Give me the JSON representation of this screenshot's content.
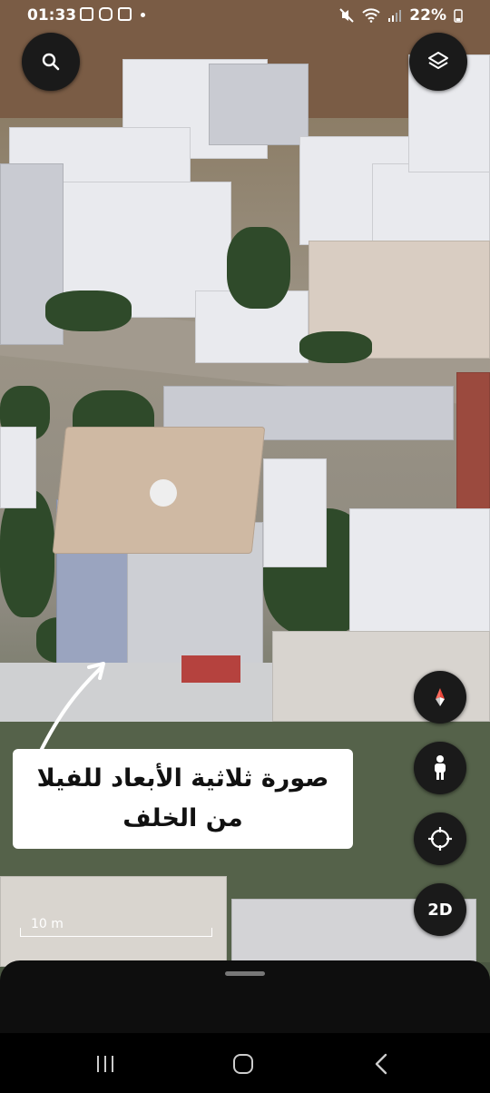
{
  "status_bar": {
    "time": "01:33",
    "battery": "22%"
  },
  "map": {
    "annotation": "صورة ثلاثية الأبعاد للفيلا من الخلف",
    "scale_label": "10 m"
  },
  "controls": {
    "dimension_toggle_label": "2D"
  },
  "colors": {
    "button_bg": "#1a1a1a",
    "compass_red": "#e8473b",
    "sheet_bg": "#0e0e0e"
  }
}
